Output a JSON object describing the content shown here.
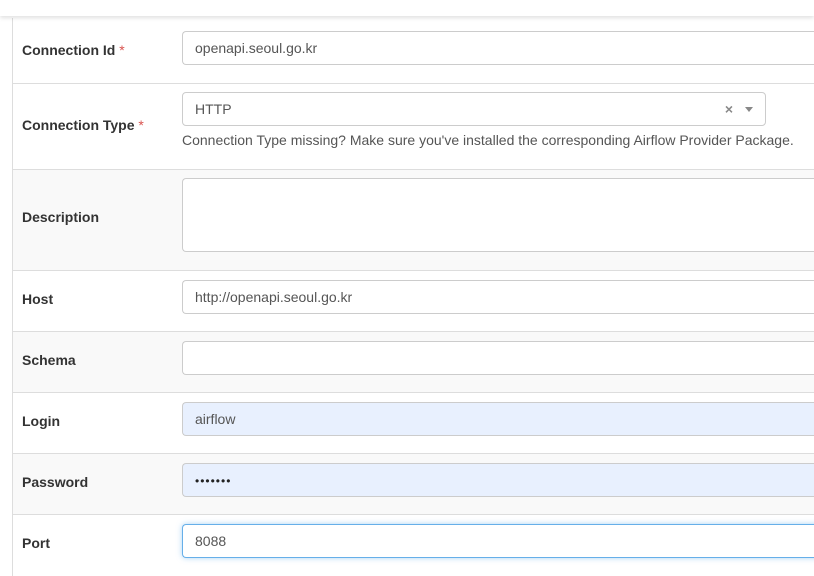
{
  "form": {
    "connection_id": {
      "label": "Connection Id",
      "required_mark": "*",
      "value": "openapi.seoul.go.kr"
    },
    "connection_type": {
      "label": "Connection Type",
      "required_mark": "*",
      "value": "HTTP",
      "clear_glyph": "×",
      "help_text": "Connection Type missing? Make sure you've installed the corresponding Airflow Provider Package."
    },
    "description": {
      "label": "Description",
      "value": ""
    },
    "host": {
      "label": "Host",
      "value": "http://openapi.seoul.go.kr"
    },
    "schema": {
      "label": "Schema",
      "value": ""
    },
    "login": {
      "label": "Login",
      "value": "airflow"
    },
    "password": {
      "label": "Password",
      "value": "•••••••"
    },
    "port": {
      "label": "Port",
      "value": "8088"
    }
  },
  "colors": {
    "required": "#d9534f",
    "autofill_bg": "#e8f0fe",
    "focus_border": "#66afe9",
    "border": "#cccccc",
    "row_border": "#dddddd"
  }
}
